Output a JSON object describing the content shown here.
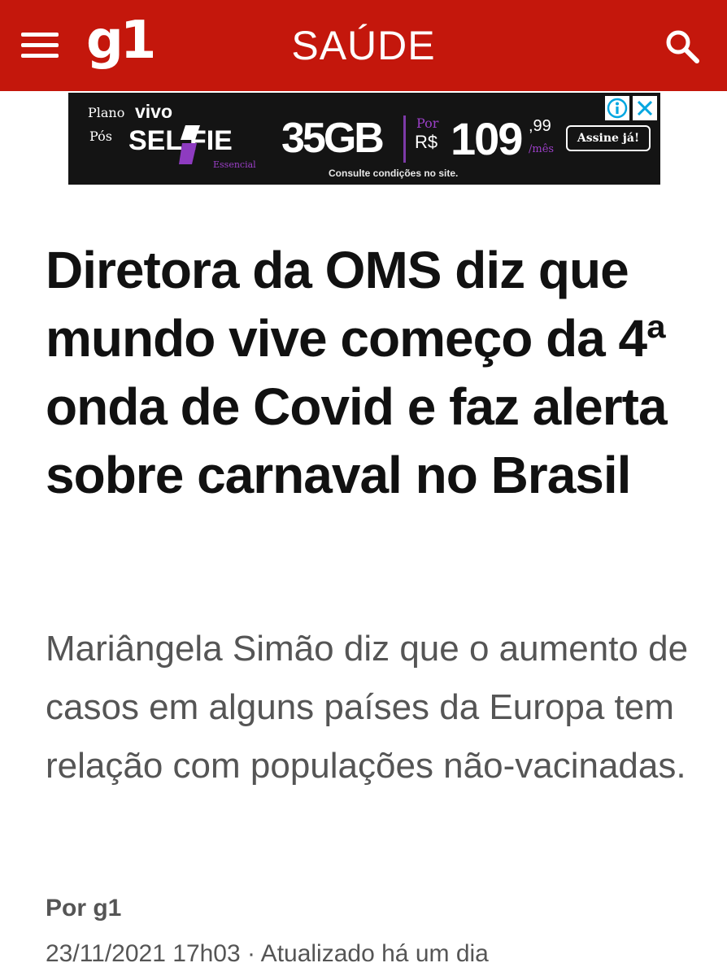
{
  "header": {
    "logo": "g1",
    "section": "SAÚDE",
    "menu_icon": "hamburger-menu-icon",
    "search_icon": "search-icon",
    "background": "#c4170c"
  },
  "ad": {
    "plano": "Plano",
    "vivo": "vivo",
    "pos": "Pós",
    "selfie": "SEL  FIE",
    "essencial": "Essencial",
    "data": "35GB",
    "por": "Por",
    "currency": "R$",
    "price": "109",
    "cents": ",99",
    "per_month": "/mês",
    "cta": "Assine já!",
    "footnote": "Consulte condições no site.",
    "info_icon": "ad-info-icon",
    "close_icon": "ad-close-icon",
    "accent": "#9b3fc7"
  },
  "article": {
    "headline": "Diretora da OMS diz que mundo vive começo da 4ª onda de Covid e faz alerta sobre carnaval no Brasil",
    "subtitle": "Mariângela Simão diz que o aumento de casos em alguns países da Europa tem relação com populações não-vacinadas.",
    "byline": "Por g1",
    "dateline": "23/11/2021 17h03 · Atualizado há um dia"
  }
}
